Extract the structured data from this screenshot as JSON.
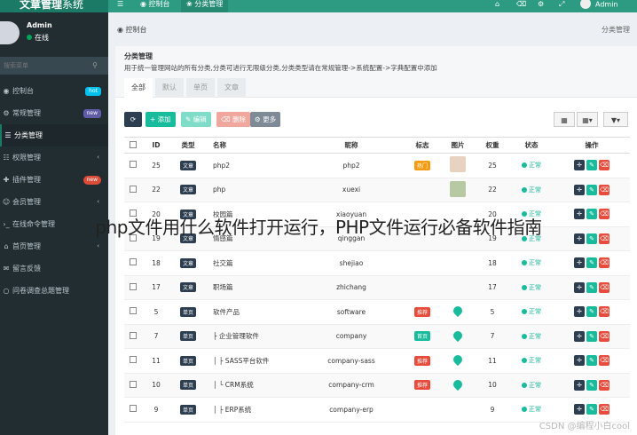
{
  "app": {
    "title_main": "文章管理",
    "title_light": "系统"
  },
  "user": {
    "name": "Admin",
    "status": "在线"
  },
  "search": {
    "placeholder": "搜索菜单"
  },
  "sidebar": {
    "items": [
      {
        "label": "控制台",
        "icon": "dashboard-icon",
        "badge": "hot"
      },
      {
        "label": "常规管理",
        "icon": "cog-icon",
        "badge": "new"
      },
      {
        "label": "分类管理",
        "icon": "list-icon",
        "badge": ""
      },
      {
        "label": "权限管理",
        "icon": "group-icon",
        "badge": ""
      },
      {
        "label": "插件管理",
        "icon": "puzzle-icon",
        "badge": "new"
      },
      {
        "label": "会员管理",
        "icon": "user-icon",
        "badge": ""
      },
      {
        "label": "在线命令管理",
        "icon": "terminal-icon",
        "badge": ""
      },
      {
        "label": "首页管理",
        "icon": "home-icon",
        "badge": ""
      },
      {
        "label": "留言反馈",
        "icon": "comment-icon",
        "badge": ""
      },
      {
        "label": "问卷调查总题管理",
        "icon": "circle-icon",
        "badge": ""
      }
    ]
  },
  "topbar": {
    "tabs": [
      {
        "label": "控制台",
        "icon": "dashboard-icon"
      },
      {
        "label": "分类管理",
        "icon": "leaf-icon"
      }
    ],
    "user_label": "Admin"
  },
  "breadcrumb": {
    "current": "控制台",
    "right": "分类管理"
  },
  "panel": {
    "title": "分类管理",
    "desc": "用于统一管理网站的所有分类,分类可进行无限级分类,分类类型请在常规管理->系统配置->字典配置中添加",
    "tabs": [
      "全部",
      "默认",
      "单页",
      "文章"
    ]
  },
  "toolbar": {
    "add": "添加",
    "edit": "编辑",
    "delete": "删除",
    "more": "更多"
  },
  "table": {
    "headers": [
      "ID",
      "类型",
      "名称",
      "昵称",
      "标志",
      "图片",
      "权重",
      "状态",
      "操作"
    ],
    "rows": [
      {
        "id": "25",
        "type": "文章",
        "name": "php2",
        "nick": "php2",
        "flag": "热门",
        "flag_kind": "hot",
        "image": "img1",
        "weight": "25",
        "status": "正常"
      },
      {
        "id": "22",
        "type": "文章",
        "name": "php",
        "nick": "xuexi",
        "flag": "",
        "flag_kind": "",
        "image": "img2",
        "weight": "22",
        "status": "正常"
      },
      {
        "id": "20",
        "type": "文章",
        "name": "校园篇",
        "nick": "xiaoyuan",
        "flag": "",
        "flag_kind": "",
        "image": "",
        "weight": "20",
        "status": "正常"
      },
      {
        "id": "19",
        "type": "文章",
        "name": "情感篇",
        "nick": "qinggan",
        "flag": "",
        "flag_kind": "",
        "image": "",
        "weight": "19",
        "status": "正常"
      },
      {
        "id": "18",
        "type": "文章",
        "name": "社交篇",
        "nick": "shejiao",
        "flag": "",
        "flag_kind": "",
        "image": "",
        "weight": "18",
        "status": "正常"
      },
      {
        "id": "17",
        "type": "文章",
        "name": "职场篇",
        "nick": "zhichang",
        "flag": "",
        "flag_kind": "",
        "image": "",
        "weight": "17",
        "status": "正常"
      },
      {
        "id": "5",
        "type": "单页",
        "name": "软件产品",
        "nick": "software",
        "flag": "推荐",
        "flag_kind": "rec",
        "image": "icon",
        "weight": "5",
        "status": "正常"
      },
      {
        "id": "7",
        "type": "单页",
        "name": "├ 企业管理软件",
        "nick": "company",
        "flag": "首页",
        "flag_kind": "idx",
        "image": "icon",
        "weight": "7",
        "status": "正常"
      },
      {
        "id": "11",
        "type": "单页",
        "name": "│ ├ SASS平台软件",
        "nick": "company-sass",
        "flag": "推荐",
        "flag_kind": "rec",
        "image": "icon",
        "weight": "11",
        "status": "正常"
      },
      {
        "id": "10",
        "type": "单页",
        "name": "│ └ CRM系统",
        "nick": "company-crm",
        "flag": "推荐",
        "flag_kind": "rec",
        "image": "icon",
        "weight": "10",
        "status": "正常"
      },
      {
        "id": "9",
        "type": "单页",
        "name": "│ ├ ERP系统",
        "nick": "company-erp",
        "flag": "",
        "flag_kind": "",
        "image": "",
        "weight": "9",
        "status": "正常"
      }
    ]
  },
  "overlay": {
    "title": "php文件用什么软件打开运行，PHP文件运行必备软件指南",
    "credit": "CSDN @编程小白cool"
  }
}
